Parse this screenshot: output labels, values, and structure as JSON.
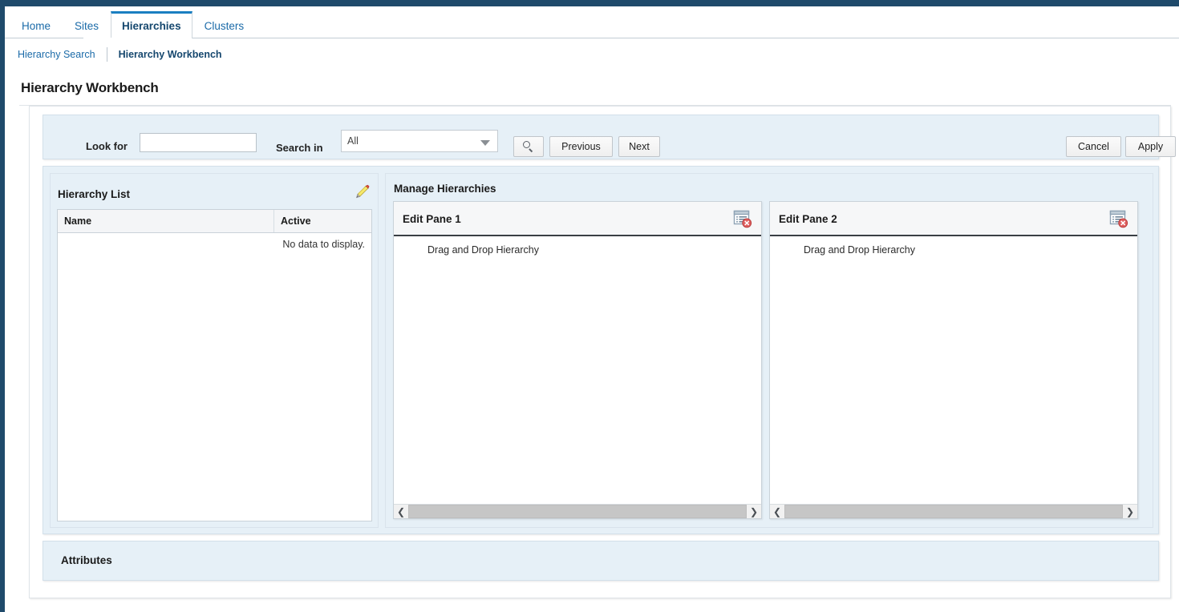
{
  "chrome": {
    "accent_navy": "#1f4a6b",
    "link_blue": "#1a6aa8",
    "active_blue": "#15476e",
    "panel_blue": "#e6f0f7"
  },
  "tabs": [
    {
      "label": "Home",
      "active": false
    },
    {
      "label": "Sites",
      "active": false
    },
    {
      "label": "Hierarchies",
      "active": true
    },
    {
      "label": "Clusters",
      "active": false
    }
  ],
  "subnav": [
    {
      "label": "Hierarchy Search",
      "active": false
    },
    {
      "label": "Hierarchy Workbench",
      "active": true
    }
  ],
  "page": {
    "title": "Hierarchy Workbench"
  },
  "search": {
    "look_for_label": "Look for",
    "look_for_value": "",
    "look_for_placeholder": "",
    "search_in_label": "Search in",
    "search_in_value": "All",
    "search_in_options": [
      "All"
    ],
    "search_icon": "search-icon",
    "previous_label": "Previous",
    "next_label": "Next",
    "cancel_label": "Cancel",
    "apply_label": "Apply"
  },
  "hierarchy_list": {
    "title": "Hierarchy List",
    "edit_icon": "pencil-icon",
    "columns": [
      "Name",
      "Active"
    ],
    "rows": [],
    "empty_message": "No data to display."
  },
  "manage_hierarchies": {
    "title": "Manage Hierarchies",
    "panes": [
      {
        "title": "Edit Pane 1",
        "close_icon": "remove-pane-icon",
        "body_text": "Drag and Drop Hierarchy",
        "scroll_left_icon": "chevron-left-icon",
        "scroll_right_icon": "chevron-right-icon"
      },
      {
        "title": "Edit Pane 2",
        "close_icon": "remove-pane-icon",
        "body_text": "Drag and Drop Hierarchy",
        "scroll_left_icon": "chevron-left-icon",
        "scroll_right_icon": "chevron-right-icon"
      }
    ]
  },
  "attributes": {
    "title": "Attributes"
  }
}
